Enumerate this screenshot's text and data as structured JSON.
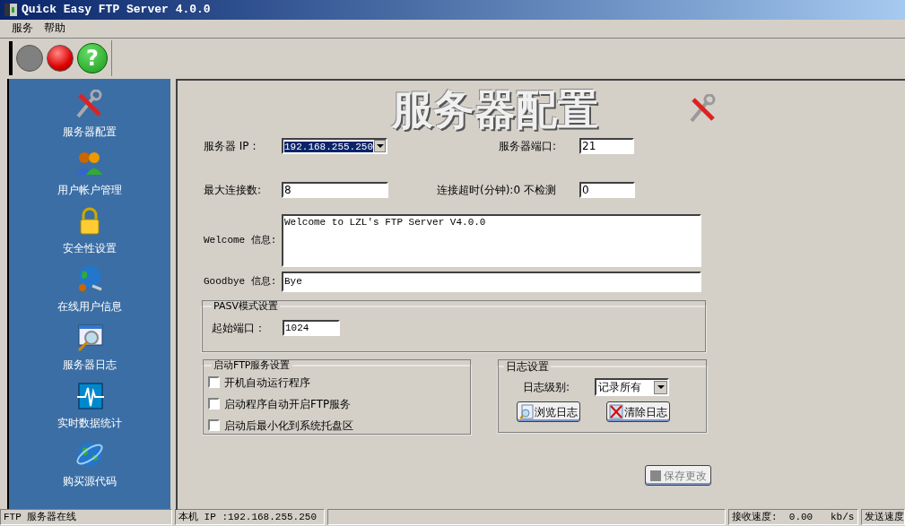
{
  "window": {
    "title": "Quick Easy FTP Server 4.0.0"
  },
  "menu": [
    "服务",
    "帮助"
  ],
  "toolbar": [
    {
      "kind": "start",
      "disabled": true
    },
    {
      "kind": "stop",
      "disabled": false
    },
    {
      "kind": "help",
      "label": "?"
    }
  ],
  "sidebar": {
    "items": [
      {
        "label": "服务器配置"
      },
      {
        "label": "用户帐户管理"
      },
      {
        "label": "安全性设置"
      },
      {
        "label": "在线用户信息"
      },
      {
        "label": "服务器日志"
      },
      {
        "label": "实时数据统计"
      },
      {
        "label": "购买源代码"
      }
    ]
  },
  "page_title": "服务器配置",
  "server_ip": {
    "label": "服务器 IP :",
    "value": "192.168.255.250"
  },
  "server_port": {
    "label": "服务器端口:",
    "value": "21"
  },
  "max_connections": {
    "label": "最大连接数:",
    "value": "8"
  },
  "timeout": {
    "label": "连接超时(分钟):0 不检测",
    "value": "0"
  },
  "welcome": {
    "label": "Welcome 信息:",
    "value": "Welcome to LZL's FTP Server V4.0.0"
  },
  "goodbye": {
    "label": "Goodbye 信息:",
    "value": "Bye"
  },
  "pasv": {
    "title": "PASV模式设置",
    "start_port": {
      "label": "起始端口：",
      "value": "1024"
    }
  },
  "startup": {
    "title": "启动FTP服务设置",
    "options": [
      {
        "label": "开机自动运行程序",
        "checked": false
      },
      {
        "label": "启动程序自动开启FTP服务",
        "checked": false
      },
      {
        "label": "启动后最小化到系统托盘区",
        "checked": false
      }
    ]
  },
  "log": {
    "title": "日志设置",
    "level_label": "日志级别:",
    "level_value": "记录所有",
    "buttons": [
      {
        "kind": "browse",
        "label": "浏览日志"
      },
      {
        "kind": "clear",
        "label": "清除日志"
      }
    ]
  },
  "save_button": {
    "label": "保存更改",
    "disabled": true
  },
  "status_bar": [
    "FTP 服务器在线",
    "本机 IP :192.168.255.250",
    "接收速度:  0.00   kb/s",
    "发送速度"
  ]
}
